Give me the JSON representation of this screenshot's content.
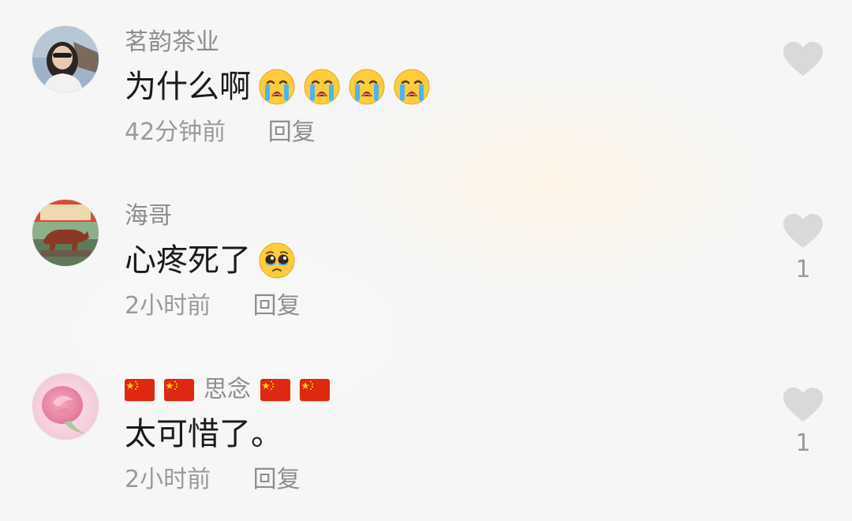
{
  "comments": [
    {
      "username": "茗韵茶业",
      "text": "为什么啊",
      "emoji": "loudly-crying-face",
      "emoji_count": 4,
      "time": "42分钟前",
      "reply_label": "回复",
      "like_count": ""
    },
    {
      "username": "海哥",
      "text": "心疼死了",
      "emoji": "pleading-face",
      "emoji_count": 1,
      "time": "2小时前",
      "reply_label": "回复",
      "like_count": "1"
    },
    {
      "username_prefix_flags": [
        "china-flag",
        "china-flag"
      ],
      "username": "思念",
      "username_suffix_flags": [
        "china-flag",
        "china-flag"
      ],
      "text": "太可惜了。",
      "time": "2小时前",
      "reply_label": "回复",
      "like_count": "1"
    }
  ],
  "colors": {
    "username": "#8d8d8d",
    "text": "#1a1a1a",
    "meta": "#9a9a9a",
    "heart": "#d9d9d9",
    "background": "#f6f6f6"
  }
}
